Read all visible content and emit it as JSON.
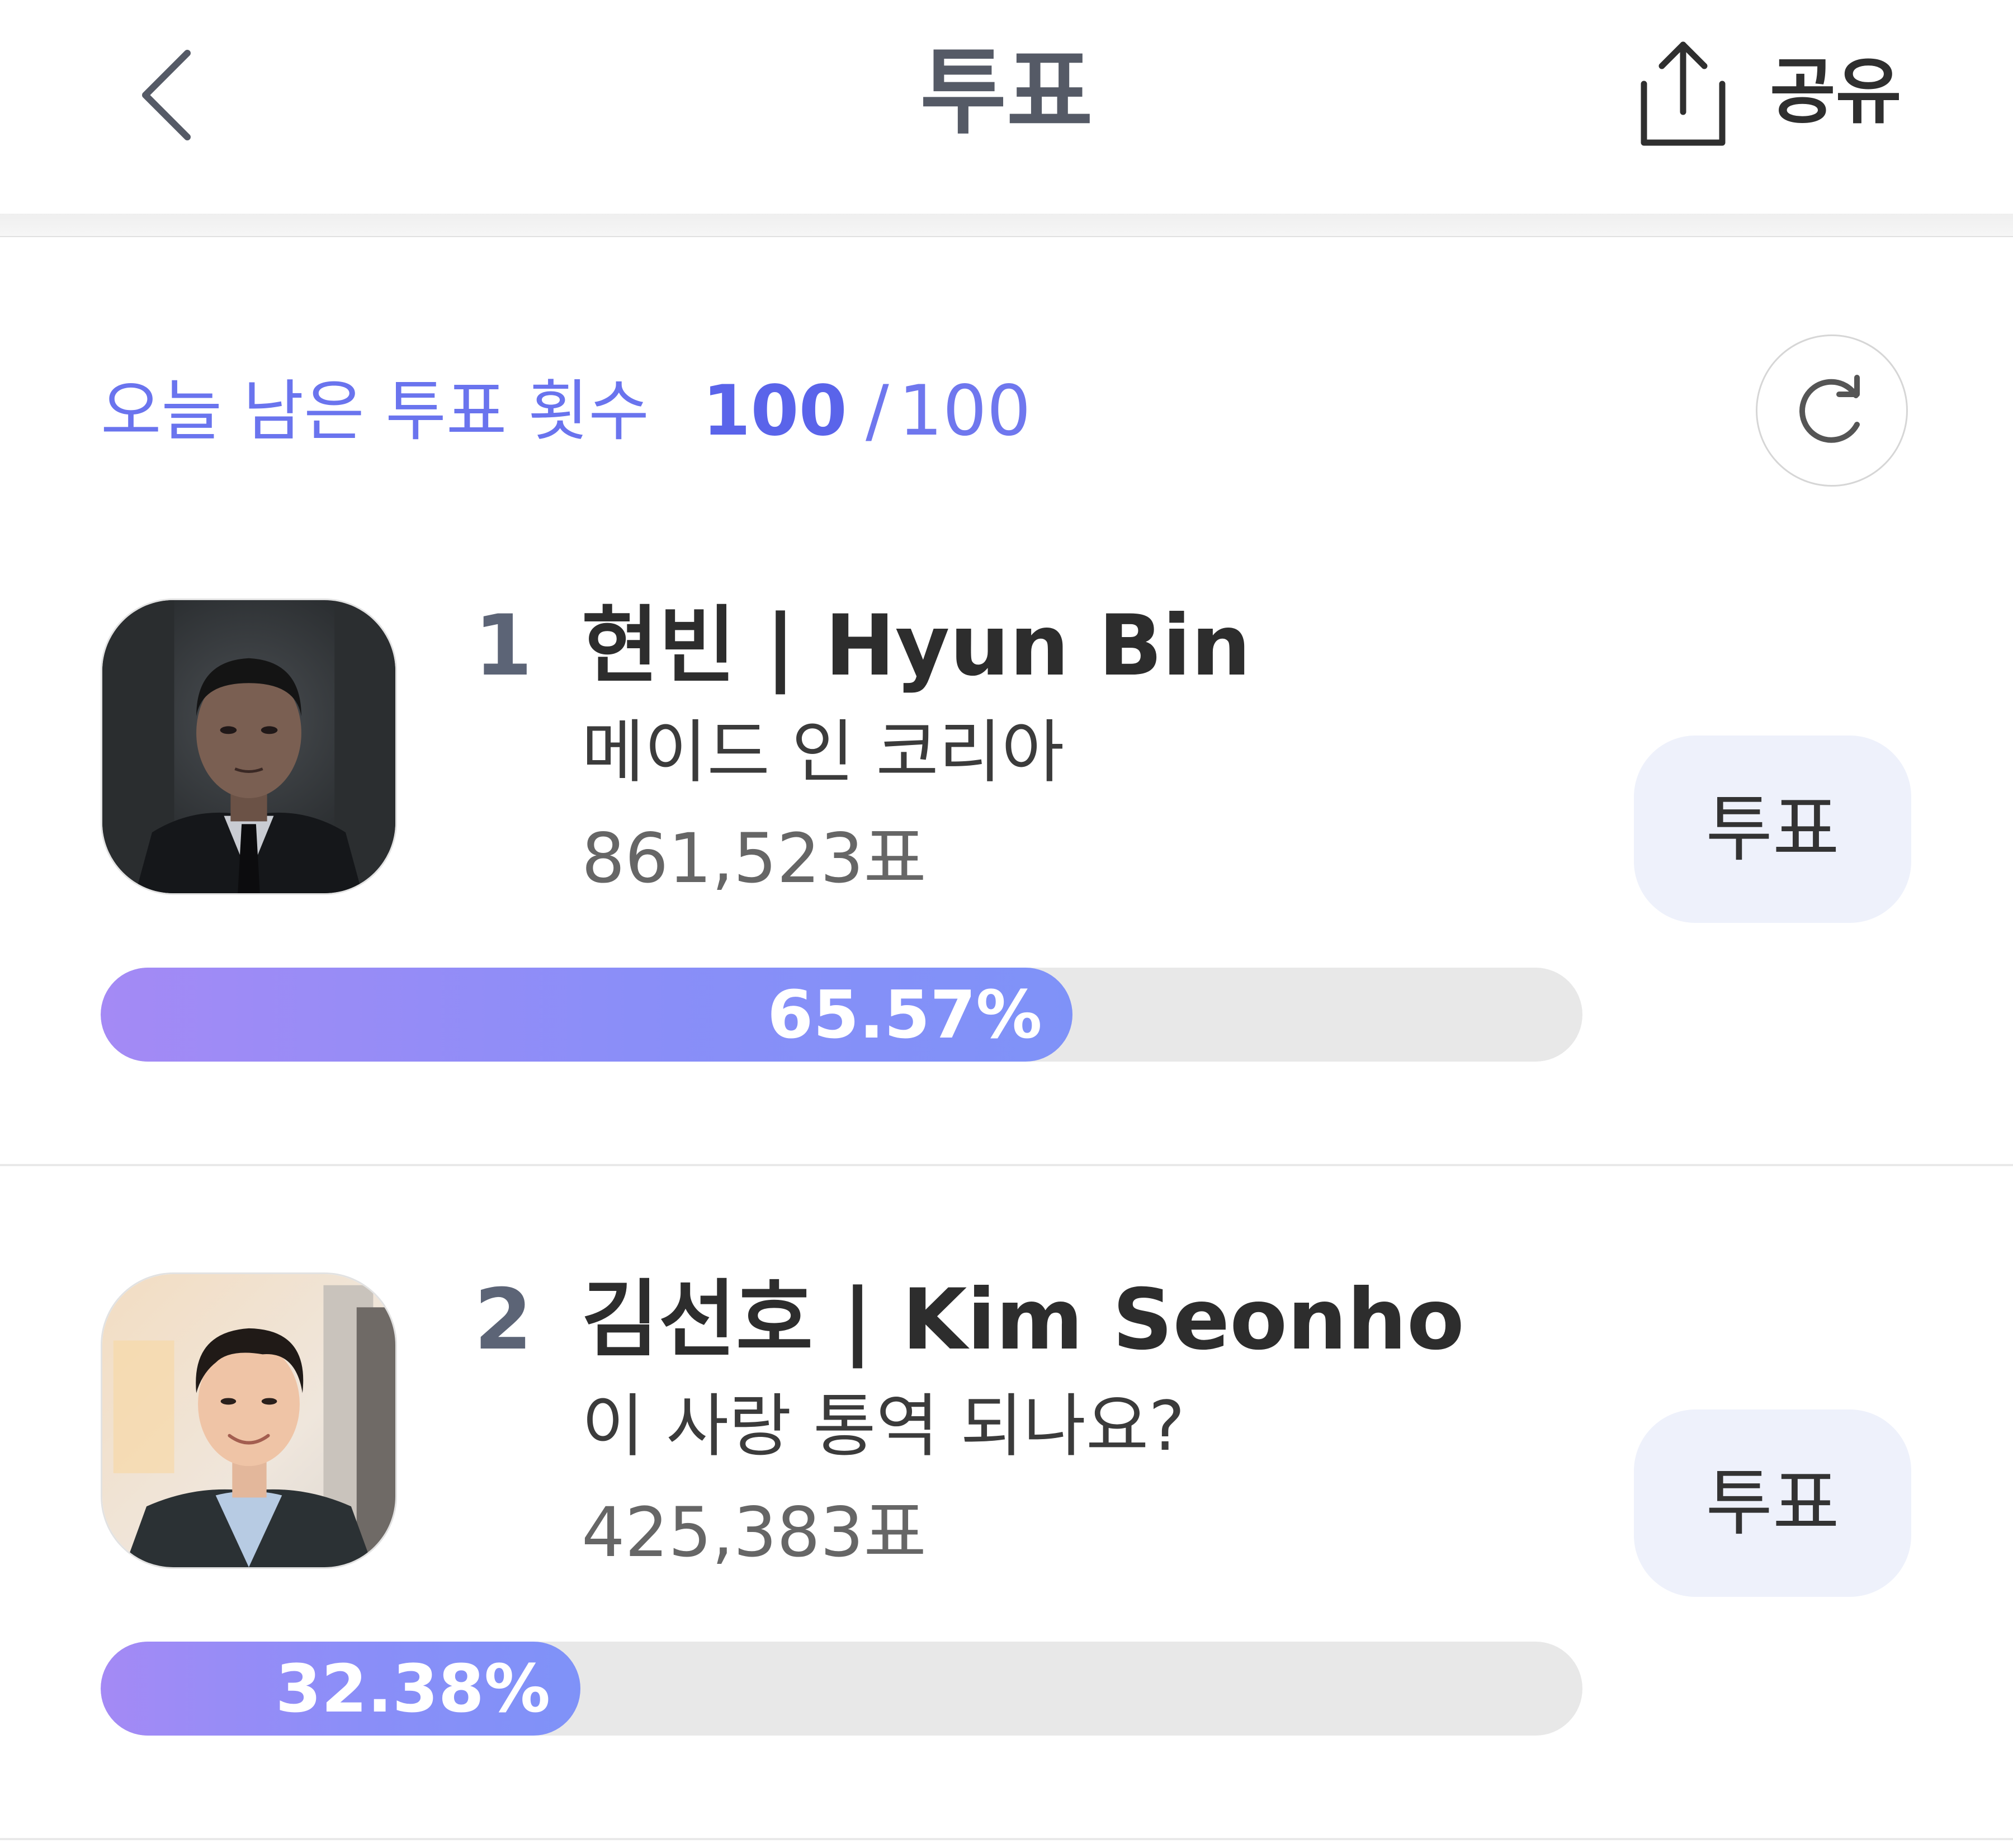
{
  "header": {
    "back_icon": "chevron-left-icon",
    "title": "투표",
    "share_icon": "share-upload-icon",
    "share_label": "공유"
  },
  "remaining": {
    "label": "오늘 남은 투표 횟수",
    "count": "100",
    "separator": "/",
    "total": "100",
    "refresh_icon": "refresh-icon"
  },
  "colors": {
    "accent": "#5a64ea",
    "bar_start": "#a48af5",
    "bar_end": "#7f92f8",
    "bar_track": "#e8e8e8",
    "vote_button_bg": "#eef1fb"
  },
  "candidates": [
    {
      "rank": "1",
      "name": "현빈 | Hyun Bin",
      "work": "메이드 인 코리아",
      "votes": "861,523표",
      "percent_label": "65.57%",
      "percent": 65.57,
      "vote_label": "투표"
    },
    {
      "rank": "2",
      "name": "김선호 | Kim Seonho",
      "work": "이 사랑 통역 되나요?",
      "votes": "425,383표",
      "percent_label": "32.38%",
      "percent": 32.38,
      "vote_label": "투표"
    }
  ]
}
